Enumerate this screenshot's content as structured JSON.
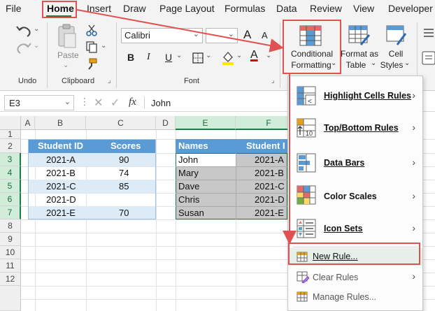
{
  "menu": {
    "tabs": [
      "File",
      "Home",
      "Insert",
      "Draw",
      "Page Layout",
      "Formulas",
      "Data",
      "Review",
      "View",
      "Developer"
    ],
    "active": "Home"
  },
  "ribbon": {
    "undo_label": "Undo",
    "clipboard_label": "Clipboard",
    "paste_label": "Paste",
    "font_label": "Font",
    "font_name": "Calibri",
    "bold": "B",
    "italic": "I",
    "underline": "U",
    "font_grow": "A",
    "font_shrink": "A",
    "font_color_letter": "A",
    "conditional_formatting": [
      "Conditional",
      "Formatting"
    ],
    "format_as_table": [
      "Format as",
      "Table"
    ],
    "cell_styles": [
      "Cell",
      "Styles"
    ]
  },
  "formula_bar": {
    "name_box": "E3",
    "fx": "fx",
    "value": "John"
  },
  "grid": {
    "columns": [
      "A",
      "B",
      "C",
      "D",
      "E",
      "F"
    ],
    "rows": [
      "1",
      "2",
      "3",
      "4",
      "5",
      "6",
      "7",
      "8",
      "9",
      "10",
      "11",
      "12"
    ],
    "table1": {
      "headers": [
        "Student ID",
        "Scores"
      ],
      "rows": [
        [
          "2021-A",
          "90"
        ],
        [
          "2021-B",
          "74"
        ],
        [
          "2021-C",
          "85"
        ],
        [
          "2021-D",
          ""
        ],
        [
          "2021-E",
          "70"
        ]
      ]
    },
    "table2": {
      "headers": [
        "Names",
        "Student I"
      ],
      "rows": [
        [
          "John",
          "2021-A"
        ],
        [
          "Mary",
          "2021-B"
        ],
        [
          "Dave",
          "2021-C"
        ],
        [
          "Chris",
          "2021-D"
        ],
        [
          "Susan",
          "2021-E"
        ]
      ]
    }
  },
  "dropdown": {
    "items": [
      {
        "label": "Highlight Cells Rules",
        "icon": "highlight-cells-icon",
        "submenu": true
      },
      {
        "label": "Top/Bottom Rules",
        "icon": "top-bottom-icon",
        "submenu": true
      },
      {
        "label": "Data Bars",
        "icon": "data-bars-icon",
        "submenu": true
      },
      {
        "label": "Color Scales",
        "icon": "color-scales-icon",
        "submenu": true
      },
      {
        "label": "Icon Sets",
        "icon": "icon-sets-icon",
        "submenu": true
      }
    ],
    "new_rule": "New Rule...",
    "clear_rules": "Clear Rules",
    "manage_rules": "Manage Rules..."
  },
  "colors": {
    "accent_green": "#1e7b45",
    "table_header": "#5b9bd5",
    "table_band": "#ddebf7",
    "selection_gray": "#c8c8c8",
    "annotation_red": "#e05252"
  }
}
